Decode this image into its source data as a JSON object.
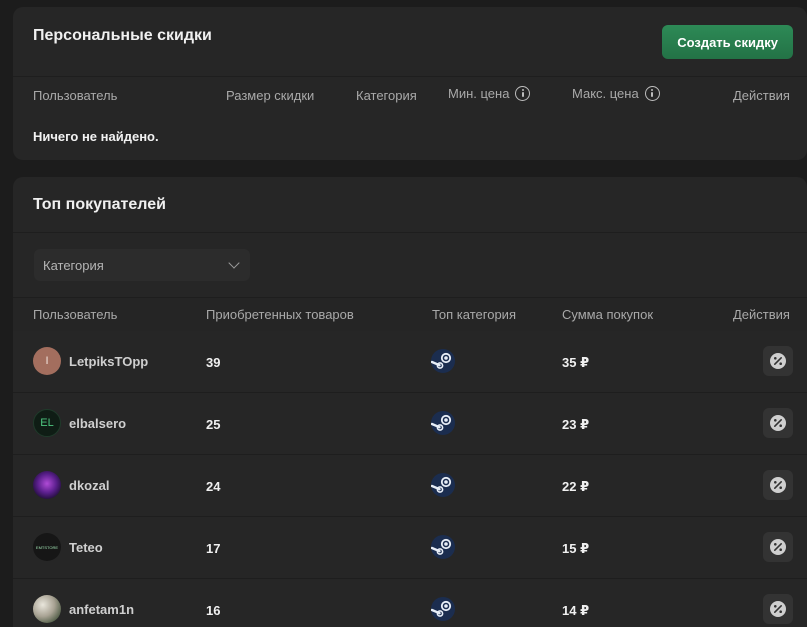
{
  "discounts": {
    "title": "Персональные скидки",
    "create_button": "Создать скидку",
    "columns": {
      "user": "Пользователь",
      "size": "Размер скидки",
      "category": "Категория",
      "min_price": "Мин. цена",
      "max_price": "Макс. цена",
      "actions": "Действия"
    },
    "empty_text": "Ничего не найдено."
  },
  "buyers": {
    "title": "Топ покупателей",
    "category_select": "Категория",
    "columns": {
      "user": "Пользователь",
      "purchased": "Приобретенных товаров",
      "top_category": "Топ категория",
      "total": "Сумма покупок",
      "actions": "Действия"
    },
    "rows": [
      {
        "name": "LetpiksTOpp",
        "purchased": "39",
        "category_icon": "steam-icon",
        "total": "35 ₽",
        "avatar": "I"
      },
      {
        "name": "elbalsero",
        "purchased": "25",
        "category_icon": "steam-icon",
        "total": "23 ₽",
        "avatar": "EL"
      },
      {
        "name": "dkozal",
        "purchased": "24",
        "category_icon": "steam-icon",
        "total": "22 ₽",
        "avatar": ""
      },
      {
        "name": "Teteo",
        "purchased": "17",
        "category_icon": "steam-icon",
        "total": "15 ₽",
        "avatar": "EMTSTORE"
      },
      {
        "name": "anfetam1n",
        "purchased": "16",
        "category_icon": "steam-icon",
        "total": "14 ₽",
        "avatar": ""
      }
    ]
  },
  "colors": {
    "background": "#1c1c1c",
    "card": "#262626",
    "accent_green": "#2d8a56"
  }
}
